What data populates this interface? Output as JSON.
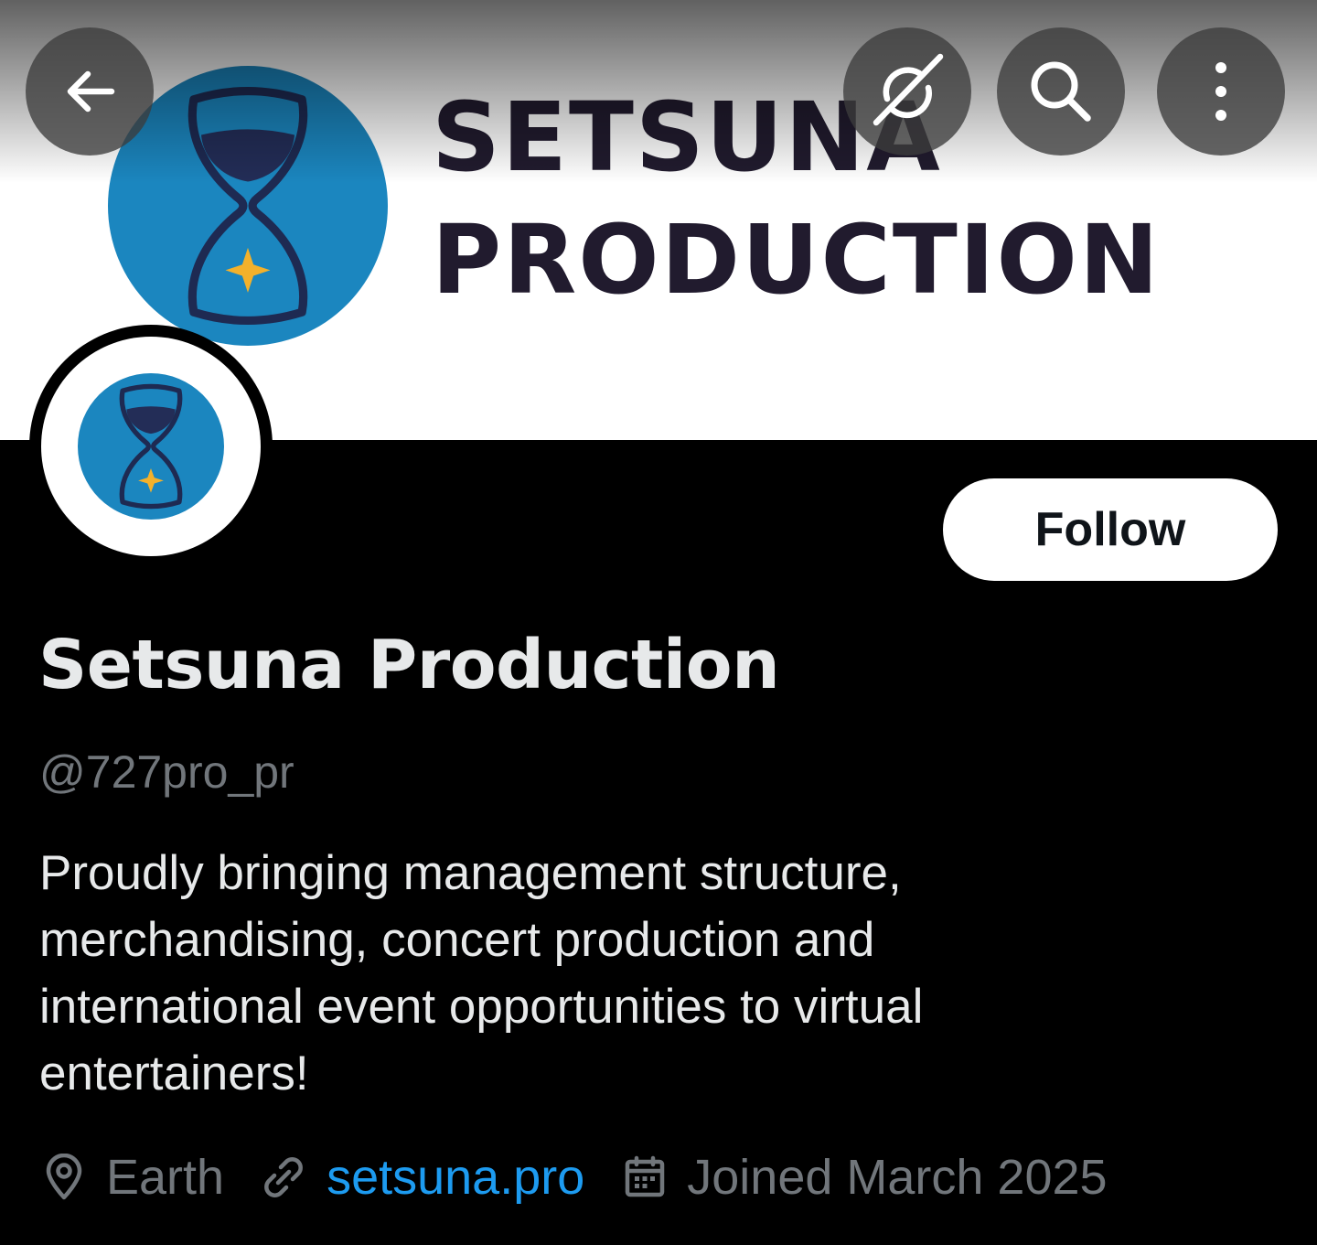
{
  "banner": {
    "wordmark_line1": "SETSUNA",
    "wordmark_line2": "PRODUCTION"
  },
  "header": {
    "back_icon": "arrow-left-icon",
    "grok_icon": "grok-icon",
    "search_icon": "search-icon",
    "more_icon": "more-vertical-icon"
  },
  "profile": {
    "display_name": "Setsuna Production",
    "handle": "@727pro_pr",
    "bio_lines": [
      "Proudly bringing management structure,",
      "merchandising, concert production and",
      "international event opportunities to virtual",
      "entertainers!"
    ],
    "follow_label": "Follow",
    "location": "Earth",
    "website": "setsuna.pro",
    "joined": "Joined March 2025"
  },
  "colors": {
    "background": "#000000",
    "text_primary": "#e7e9ea",
    "text_secondary": "#71767b",
    "link": "#1d9bf0",
    "logo_blue": "#1b86bf",
    "logo_navy": "#1e2a52",
    "logo_star": "#f3b12b",
    "wordmark": "#211b2e"
  }
}
